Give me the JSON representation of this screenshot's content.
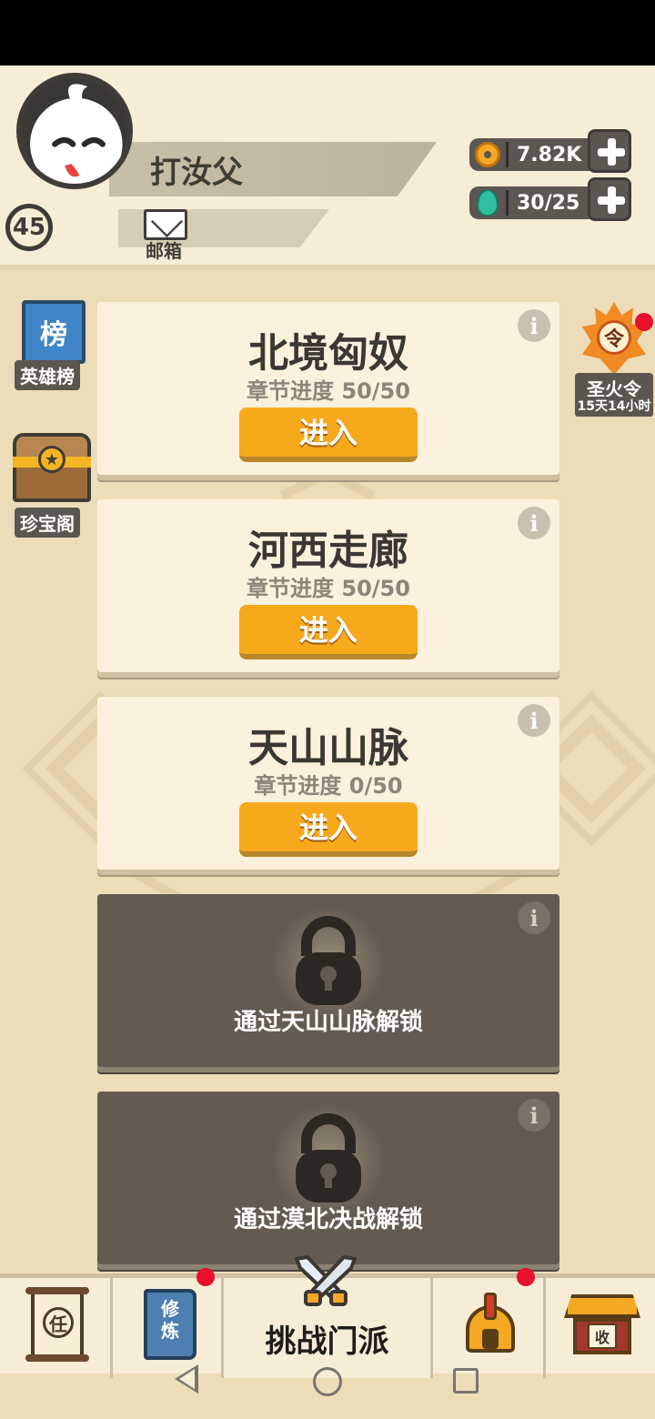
{
  "player": {
    "name": "打汝父",
    "level": "45",
    "mail_label": "邮箱"
  },
  "currencies": {
    "coins": "7.82K",
    "stamina": "30/25"
  },
  "side_left": {
    "leaderboard_icon_char": "榜",
    "leaderboard_label": "英雄榜",
    "treasure_label": "珍宝阁"
  },
  "side_right": {
    "token_char": "令",
    "token_label": "圣火令",
    "token_timer": "15天14小时"
  },
  "chapters": [
    {
      "title": "北境匈奴",
      "progress": "章节进度 50/50",
      "button": "进入",
      "locked": false
    },
    {
      "title": "河西走廊",
      "progress": "章节进度 50/50",
      "button": "进入",
      "locked": false
    },
    {
      "title": "天山山脉",
      "progress": "章节进度 0/50",
      "button": "进入",
      "locked": false
    },
    {
      "unlock_text": "通过天山山脉解锁",
      "locked": true
    },
    {
      "unlock_text": "通过漠北决战解锁",
      "locked": true
    }
  ],
  "info_glyph": "i",
  "bottom_nav": {
    "task_char": "任",
    "cultivate_chars": [
      "修",
      "炼"
    ],
    "challenge_label": "挑战门派",
    "collect_char": "收"
  },
  "colors": {
    "enter_button": "#f7a91c",
    "card_bg": "#fbf1dc",
    "locked_card_bg": "#635b52",
    "notification_dot": "#e8102a"
  }
}
